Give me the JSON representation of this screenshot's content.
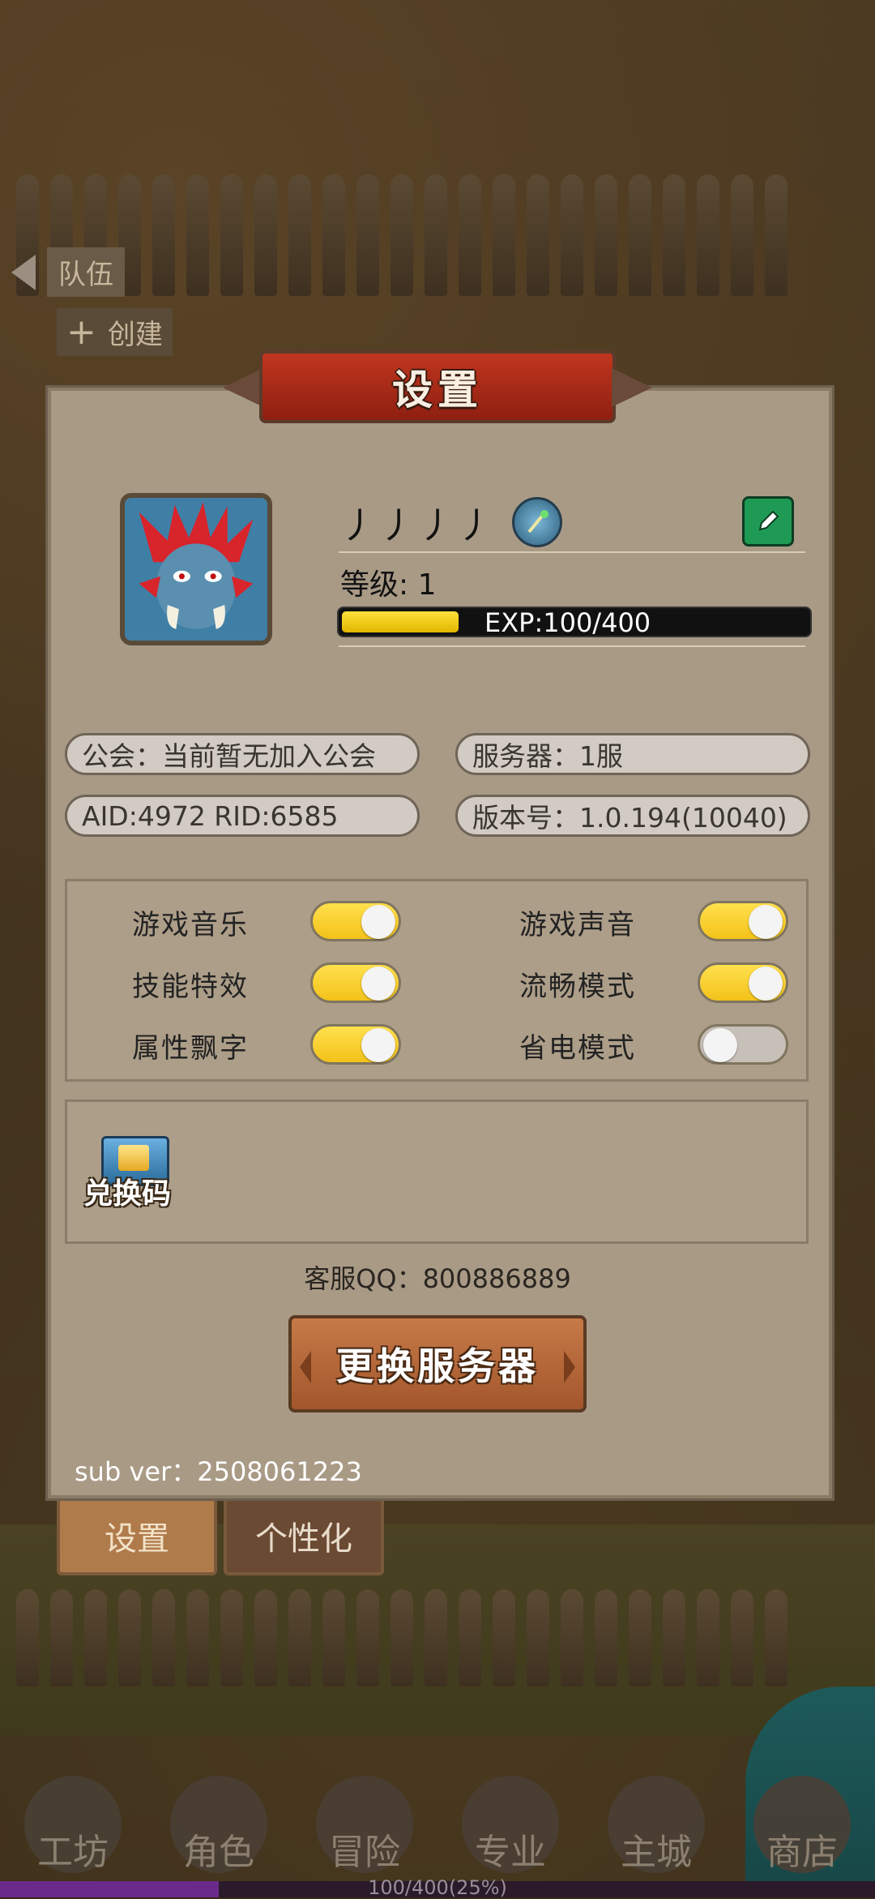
{
  "background": {
    "team_label": "队伍",
    "create_label": "创建",
    "tabs": [
      {
        "label": "设置",
        "active": true
      },
      {
        "label": "个性化",
        "active": false
      }
    ],
    "nav": [
      {
        "label": "工坊"
      },
      {
        "label": "角色"
      },
      {
        "label": "冒险"
      },
      {
        "label": "专业"
      },
      {
        "label": "主城"
      },
      {
        "label": "商店"
      }
    ],
    "bottom_exp_text": "100/400(25%)",
    "bottom_exp_fraction": 0.25
  },
  "dialog": {
    "title": "设置",
    "player": {
      "name": "丿丿丿丿",
      "badge_icon": "staff-badge-icon",
      "level_text": "等级: 1",
      "exp_text": "EXP:100/400",
      "exp_fraction": 0.25
    },
    "info": {
      "guild": "公会：当前暂无加入公会",
      "server": "服务器：1服",
      "ids": "AID:4972   RID:6585",
      "version": "版本号：1.0.194(10040)"
    },
    "settings": [
      {
        "label": "游戏音乐",
        "on": true
      },
      {
        "label": "游戏声音",
        "on": true
      },
      {
        "label": "技能特效",
        "on": true
      },
      {
        "label": "流畅模式",
        "on": true
      },
      {
        "label": "属性飘字",
        "on": true
      },
      {
        "label": "省电模式",
        "on": false
      }
    ],
    "redeem_label": "兑换码",
    "support_qq": "客服QQ：800886889",
    "change_server_label": "更换服务器",
    "sub_version": "sub ver：2508061223"
  },
  "colors": {
    "toggle_on": "#f3c21a",
    "toggle_off": "#c7c0b8",
    "exp_fill": "#ffd91a",
    "title_ribbon": "#b0301a",
    "edit_button": "#1f9a55"
  }
}
